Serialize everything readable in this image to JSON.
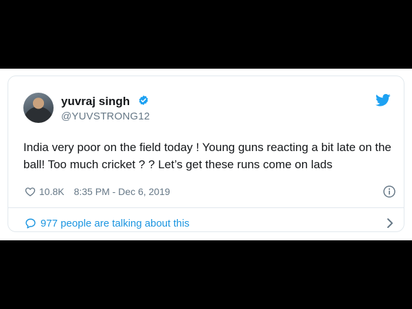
{
  "tweet": {
    "user": {
      "name": "yuvraj singh",
      "handle": "@YUVSTRONG12",
      "verified": true
    },
    "text": "India very poor on the field today ! Young guns reacting a bit late on the ball! Too much cricket ? ? Let’s get these runs come on lads",
    "likes": "10.8K",
    "timestamp": "8:35 PM - Dec 6, 2019",
    "talking": "977 people are talking about this"
  },
  "icons": {
    "bird": "twitter-bird-icon",
    "verified": "verified-badge-icon",
    "like": "heart-icon",
    "info": "info-icon",
    "reply": "speech-bubble-icon",
    "chevron": "chevron-right-icon"
  },
  "colors": {
    "twitter_blue": "#1da1f2",
    "link_blue": "#1b95e0",
    "text": "#14171a",
    "muted": "#657786",
    "border": "#e1e8ed"
  }
}
